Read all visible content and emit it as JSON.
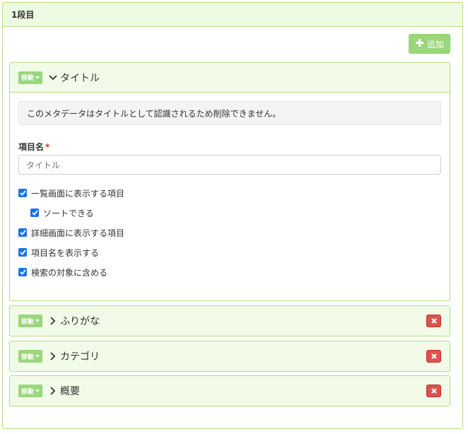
{
  "section": {
    "title": "1段目"
  },
  "toolbar": {
    "add_label": "追加",
    "add_icon": "plus-icon"
  },
  "colors": {
    "accent": "#9ad77c",
    "panel_border": "#b5dc86",
    "panel_head": "#f1fbe8",
    "danger": "#d9534f",
    "checkbox": "#1a73e8"
  },
  "items": [
    {
      "move_label": "移動",
      "title": "タイトル",
      "expanded": true,
      "notice": "このメタデータはタイトルとして認識されるため削除できません。",
      "field_label": "項目名",
      "required_mark": "*",
      "field_value": "タイトル",
      "checkboxes": [
        {
          "label": "一覧画面に表示する項目",
          "checked": true
        },
        {
          "label": "ソートできる",
          "checked": true
        },
        {
          "label": "詳細画面に表示する項目",
          "checked": true
        },
        {
          "label": "項目名を表示する",
          "checked": true
        },
        {
          "label": "検索の対象に含める",
          "checked": true
        }
      ]
    },
    {
      "move_label": "移動",
      "title": "ふりがな",
      "expanded": false
    },
    {
      "move_label": "移動",
      "title": "カテゴリ",
      "expanded": false
    },
    {
      "move_label": "移動",
      "title": "概要",
      "expanded": false
    }
  ]
}
